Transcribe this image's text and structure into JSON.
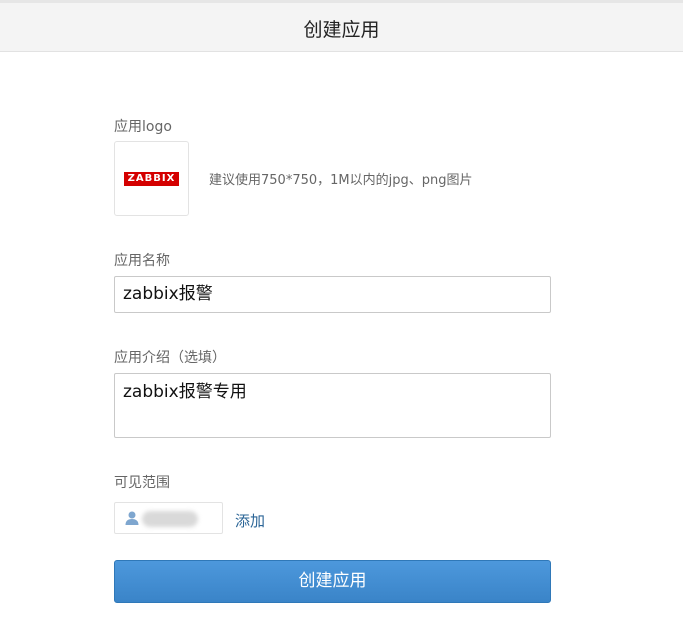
{
  "header": {
    "title": "创建应用"
  },
  "form": {
    "logo": {
      "label": "应用logo",
      "image_text": "ZABBIX",
      "hint": "建议使用750*750，1M以内的jpg、png图片"
    },
    "name": {
      "label": "应用名称",
      "value": "zabbix报警"
    },
    "description": {
      "label": "应用介绍（选填）",
      "value": "zabbix报警专用"
    },
    "visibility": {
      "label": "可见范围",
      "member_icon": "person-icon",
      "add_label": "添加"
    },
    "submit_label": "创建应用"
  },
  "colors": {
    "primary_button": "#3a84c8",
    "link": "#2a6496",
    "logo_red": "#d40000"
  }
}
